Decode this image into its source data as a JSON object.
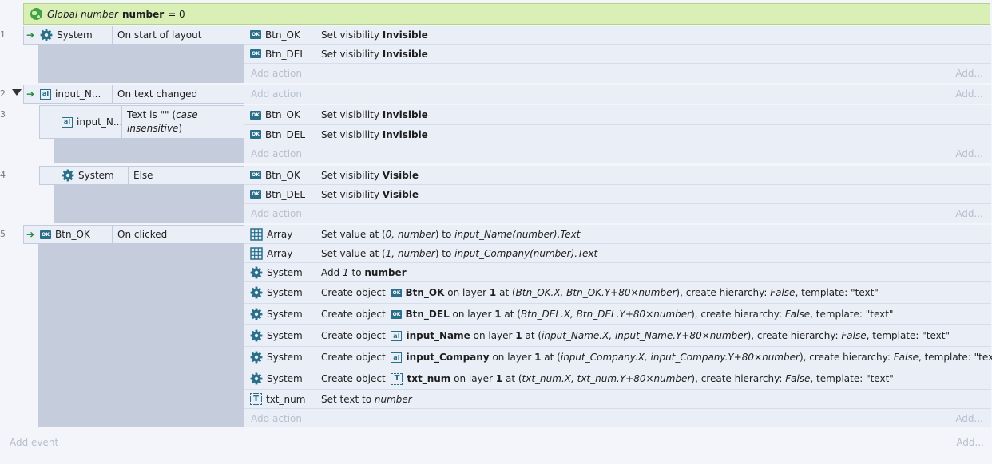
{
  "global_var": {
    "prefix": "Global number",
    "name": "number",
    "suffix": "= 0"
  },
  "events": [
    {
      "num": "1",
      "object": "System",
      "condition": "On start of layout"
    },
    {
      "num": "2",
      "object": "input_N...",
      "condition": "On text changed"
    },
    {
      "num": "3",
      "object": "input_N...",
      "condition_pre": "Text is \"\" (",
      "condition_italic": "case insensitive",
      "condition_post": ")"
    },
    {
      "num": "4",
      "object": "System",
      "condition": "Else"
    },
    {
      "num": "5",
      "object": "Btn_OK",
      "condition": "On clicked"
    }
  ],
  "actions": {
    "e1": [
      {
        "object": "Btn_OK",
        "pre": "Set visibility ",
        "bold": "Invisible"
      },
      {
        "object": "Btn_DEL",
        "pre": "Set visibility ",
        "bold": "Invisible"
      }
    ],
    "e3": [
      {
        "object": "Btn_OK",
        "pre": "Set visibility ",
        "bold": "Invisible"
      },
      {
        "object": "Btn_DEL",
        "pre": "Set visibility ",
        "bold": "Invisible"
      }
    ],
    "e4": [
      {
        "object": "Btn_OK",
        "pre": "Set visibility ",
        "bold": "Visible"
      },
      {
        "object": "Btn_DEL",
        "pre": "Set visibility ",
        "bold": "Visible"
      }
    ],
    "e5": [
      {
        "object": "Array",
        "t1": "Set value at (",
        "t2": "0, number",
        "t3": ") to ",
        "t4": "input_Name(number).Text"
      },
      {
        "object": "Array",
        "t1": "Set value at (",
        "t2": "1, number",
        "t3": ") to ",
        "t4": "input_Company(number).Text"
      },
      {
        "object": "System",
        "t1": "Add ",
        "t2": "1",
        "t3": " to ",
        "t4": "number"
      },
      {
        "object": "System",
        "a": "Create object ",
        "name": "Btn_OK",
        "b": " on layer ",
        "layer": "1",
        "c": " at (",
        "pos": "Btn_OK.X, Btn_OK.Y+80×number",
        "d": "), create hierarchy: ",
        "h": "False",
        "e": ", template: \"text\""
      },
      {
        "object": "System",
        "a": "Create object ",
        "name": "Btn_DEL",
        "b": " on layer ",
        "layer": "1",
        "c": " at (",
        "pos": "Btn_DEL.X, Btn_DEL.Y+80×number",
        "d": "), create hierarchy: ",
        "h": "False",
        "e": ", template: \"text\""
      },
      {
        "object": "System",
        "a": "Create object ",
        "name": "input_Name",
        "b": " on layer ",
        "layer": "1",
        "c": " at (",
        "pos": "input_Name.X, input_Name.Y+80×number",
        "d": "), create hierarchy: ",
        "h": "False",
        "e": ", template: \"text\""
      },
      {
        "object": "System",
        "a": "Create object ",
        "name": "input_Company",
        "b": " on layer ",
        "layer": "1",
        "c": " at (",
        "pos": "input_Company.X, input_Company.Y+80×number",
        "d": "), create hierarchy: ",
        "h": "False",
        "e": ", template: \"text\""
      },
      {
        "object": "System",
        "a": "Create object ",
        "name": "txt_num",
        "b": " on layer ",
        "layer": "1",
        "c": " at (",
        "pos": "txt_num.X, txt_num.Y+80×number",
        "d": "), create hierarchy: ",
        "h": "False",
        "e": ", template: \"text\""
      },
      {
        "object": "txt_num",
        "t1": "Set text to ",
        "t2": "number"
      }
    ]
  },
  "add_action": "Add action",
  "add_more": "Add...",
  "add_event": "Add event",
  "colors": {
    "accent": "#2a6f8a",
    "global_bg": "#d9efb6",
    "cond_bg": "#eaeef7",
    "fill": "#c5cddc",
    "arrow": "#1f8a3a"
  }
}
